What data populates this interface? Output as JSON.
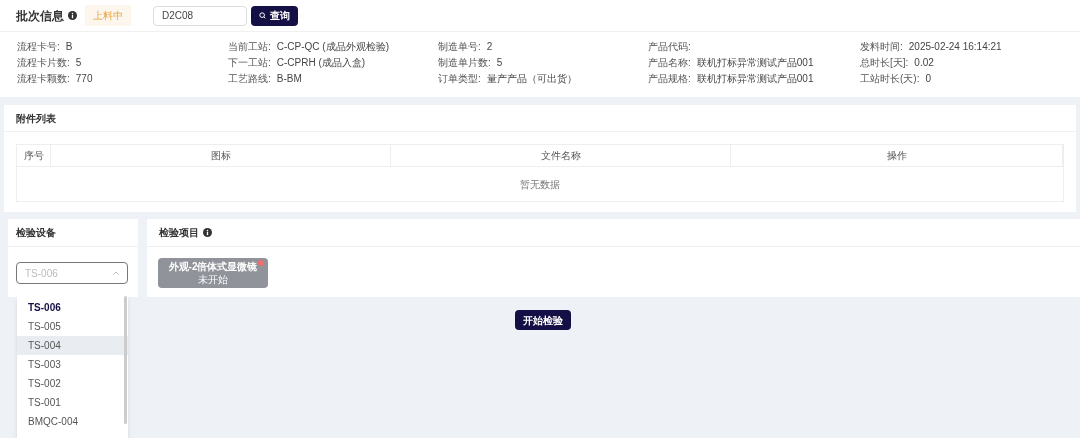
{
  "batch": {
    "title": "批次信息",
    "status": "上料中",
    "search": {
      "value": "D2C08"
    },
    "search_button": "查询"
  },
  "info": [
    {
      "label": "流程卡号:",
      "value": "B"
    },
    {
      "label": "当前工站:",
      "value": "C-CP-QC (成品外观检验)"
    },
    {
      "label": "制造单号:",
      "value": "2"
    },
    {
      "label": "产品代码:"
    },
    {
      "label": "发料时间:",
      "value": "2025-02-24 16:14:21"
    },
    {
      "label": "流程卡片数:",
      "value": "5"
    },
    {
      "label": "下一工站:",
      "value": "C-CPRH (成品入盒)"
    },
    {
      "label": "制造单片数:",
      "value": "5"
    },
    {
      "label": "产品名称:",
      "value": "联机打标异常测试产品001"
    },
    {
      "label": "总时长[天]:",
      "value": "0.02"
    },
    {
      "label": "流程卡颗数:",
      "value": "770"
    },
    {
      "label": "工艺路线:",
      "value": "B-BM"
    },
    {
      "label": "订单类型:",
      "value": "量产产品（可出货）"
    },
    {
      "label": "产品规格:",
      "value": "联机打标异常测试产品001"
    },
    {
      "label": "工站时长(天):",
      "value": "0"
    }
  ],
  "attachments": {
    "title": "附件列表",
    "columns": [
      "序号",
      "图标",
      "文件名称",
      "操作"
    ],
    "empty": "暂无数据"
  },
  "equipment": {
    "title": "检验设备",
    "select": {
      "placeholder": "TS-006",
      "expanded": true
    },
    "options": [
      {
        "label": "TS-006",
        "selected": true,
        "hovered": false
      },
      {
        "label": "TS-005",
        "selected": false,
        "hovered": false
      },
      {
        "label": "TS-004",
        "selected": false,
        "hovered": true
      },
      {
        "label": "TS-003",
        "selected": false,
        "hovered": false
      },
      {
        "label": "TS-002",
        "selected": false,
        "hovered": false
      },
      {
        "label": "TS-001",
        "selected": false,
        "hovered": false
      },
      {
        "label": "BMQC-004",
        "selected": false,
        "hovered": false
      }
    ]
  },
  "items": {
    "title": "检验项目",
    "list": [
      {
        "name": "外观-2倍体式显微镜",
        "status": "未开始",
        "flagged": true
      }
    ]
  },
  "start_button": "开始检验"
}
